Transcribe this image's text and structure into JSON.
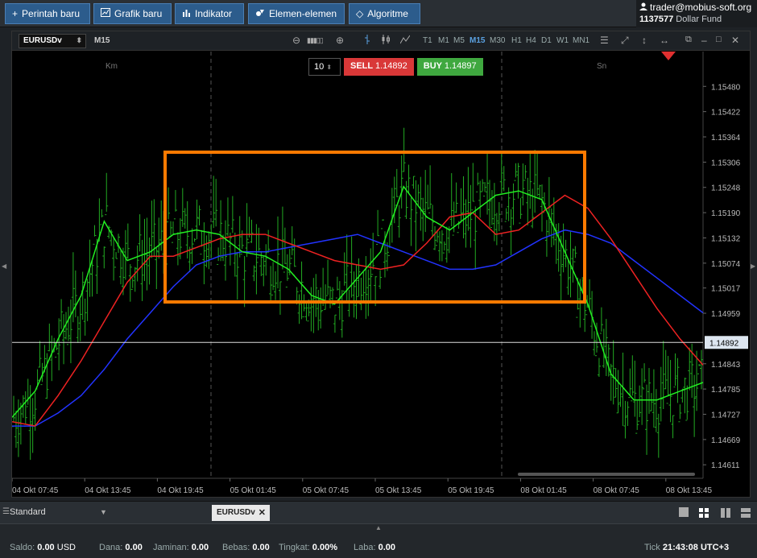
{
  "toolbar": {
    "buttons": [
      {
        "icon": "+",
        "label": "Perintah baru"
      },
      {
        "icon": "chart-icon",
        "label": "Grafik baru"
      },
      {
        "icon": "indicator-icon",
        "label": "Indikator"
      },
      {
        "icon": "elements-icon",
        "label": "Elemen-elemen"
      },
      {
        "icon": "algo-icon",
        "label": "Algoritme"
      }
    ]
  },
  "account": {
    "user": "trader@mobius-soft.org",
    "number": "1137577",
    "fund": "Dollar Fund"
  },
  "chart_window": {
    "symbol": "EURUSDv",
    "timeframe_label": "M15",
    "timeframes": [
      "T1",
      "M1",
      "M5",
      "M15",
      "M30",
      "H1",
      "H4",
      "D1",
      "W1",
      "MN1"
    ],
    "active_timeframe": "M15"
  },
  "trade": {
    "lot": "10",
    "sell_label": "SELL",
    "sell_price": "1.14892",
    "buy_label": "BUY",
    "buy_price": "1.14897"
  },
  "chart_data": {
    "type": "candlestick",
    "symbol": "EURUSDv",
    "y_ticks": [
      "1.15480",
      "1.15422",
      "1.15364",
      "1.15306",
      "1.15248",
      "1.15190",
      "1.15132",
      "1.15074",
      "1.15017",
      "1.14959",
      "1.14843",
      "1.14785",
      "1.14727",
      "1.14669",
      "1.14611"
    ],
    "current_price": "1.14892",
    "ylim": [
      1.1458,
      1.1556
    ],
    "x_ticks": [
      "04 Okt 07:45",
      "04 Okt 13:45",
      "04 Okt 19:45",
      "05 Okt 01:45",
      "05 Okt 07:45",
      "05 Okt 13:45",
      "05 Okt 19:45",
      "08 Okt 01:45",
      "08 Okt 07:45",
      "08 Okt 13:45"
    ],
    "day_labels": [
      "Km",
      "Sn"
    ],
    "series": [
      {
        "name": "",
        "color": "#2233ff",
        "values": [
          1.147,
          1.147,
          1.1473,
          1.1477,
          1.1483,
          1.149,
          1.1496,
          1.1502,
          1.1507,
          1.1509,
          1.151,
          1.151,
          1.1511,
          1.1512,
          1.1513,
          1.1514,
          1.1512,
          1.151,
          1.1508,
          1.1506,
          1.1506,
          1.1507,
          1.151,
          1.1513,
          1.1515,
          1.1514,
          1.1512,
          1.1508,
          1.1504,
          1.15,
          1.1496
        ]
      },
      {
        "name": "",
        "color": "#ee2222",
        "values": [
          1.1471,
          1.147,
          1.1477,
          1.1485,
          1.1494,
          1.1503,
          1.1509,
          1.1509,
          1.1511,
          1.1513,
          1.1514,
          1.1514,
          1.1512,
          1.151,
          1.1508,
          1.1507,
          1.1506,
          1.1507,
          1.1512,
          1.1518,
          1.1519,
          1.1514,
          1.1515,
          1.1519,
          1.1523,
          1.152,
          1.1513,
          1.1505,
          1.1497,
          1.149,
          1.1484
        ]
      },
      {
        "name": "",
        "color": "#22ee22",
        "values": [
          1.1472,
          1.1478,
          1.149,
          1.15,
          1.1517,
          1.1508,
          1.151,
          1.1514,
          1.1515,
          1.1514,
          1.151,
          1.1509,
          1.1506,
          1.15,
          1.1498,
          1.1504,
          1.151,
          1.1525,
          1.1518,
          1.1515,
          1.1519,
          1.1523,
          1.1524,
          1.1522,
          1.151,
          1.1498,
          1.1482,
          1.1476,
          1.1476,
          1.1478,
          1.148
        ]
      }
    ]
  },
  "bottom_tabs": {
    "workspace": "Standard",
    "document": "EURUSDv"
  },
  "status": {
    "saldo_label": "Saldo:",
    "saldo": "0.00",
    "currency": "USD",
    "dana_label": "Dana:",
    "dana": "0.00",
    "jaminan_label": "Jaminan:",
    "jaminan": "0.00",
    "bebas_label": "Bebas:",
    "bebas": "0.00",
    "tingkat_label": "Tingkat:",
    "tingkat": "0.00%",
    "laba_label": "Laba:",
    "laba": "0.00",
    "tick_label": "Tick",
    "time": "21:43:08",
    "tz": "UTC+3"
  }
}
